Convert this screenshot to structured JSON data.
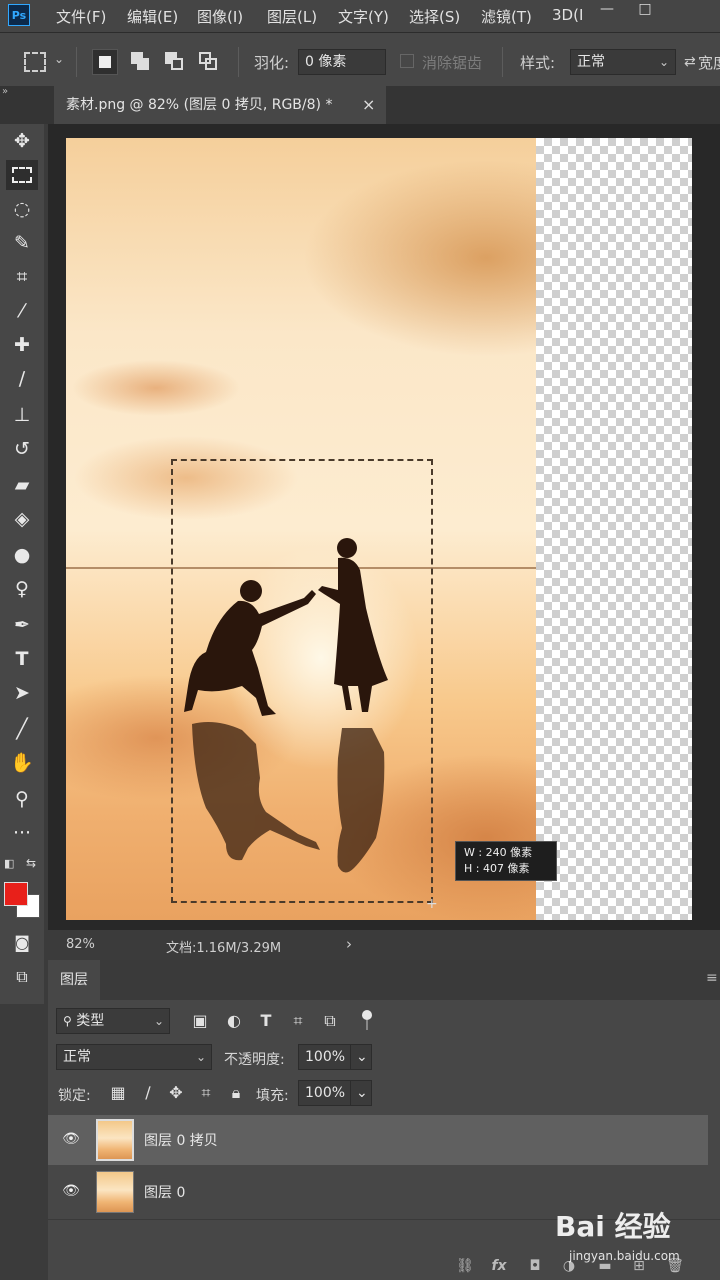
{
  "menubar": {
    "app_logo": "Ps",
    "items": [
      "文件(F)",
      "编辑(E)",
      "图像(I)",
      "图层(L)",
      "文字(Y)",
      "选择(S)",
      "滤镜(T)",
      "3D(I"
    ],
    "minimize": "—",
    "maximize": "□"
  },
  "options": {
    "feather_label": "羽化:",
    "feather_value": "0 像素",
    "antialias_label": "消除锯齿",
    "style_label": "样式:",
    "style_value": "正常",
    "width_label": "宽度"
  },
  "document_tab": {
    "title": "素材.png @ 82% (图层 0 拷贝, RGB/8) *",
    "close": "×"
  },
  "selection_tip": {
    "w": "W :  240 像素",
    "h": "H :  407 像素"
  },
  "statusbar": {
    "zoom": "82%",
    "doc_info": "文档:1.16M/3.29M",
    "arrow": "›"
  },
  "layers_panel": {
    "tab": "图层",
    "filter_kind": "类型",
    "blend_mode": "正常",
    "opacity_label": "不透明度:",
    "opacity_value": "100%",
    "lock_label": "锁定:",
    "fill_label": "填充:",
    "fill_value": "100%",
    "layers": [
      {
        "name": "图层 0 拷贝",
        "selected": true
      },
      {
        "name": "图层 0",
        "selected": false
      }
    ]
  },
  "colors": {
    "foreground": "#e8201a",
    "background": "#ffffff",
    "accent": "#31a8ff"
  },
  "watermark": {
    "name": "Bai 经验",
    "url": "jingyan.baidu.com"
  }
}
